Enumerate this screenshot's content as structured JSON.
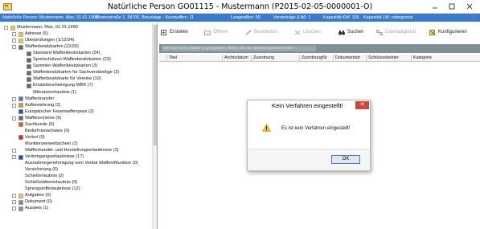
{
  "window": {
    "title": "Natürliche Person GO01115 - Mustermann (P2015-02-05-0000001-O)"
  },
  "infobar": {
    "person": "Natürliche Person: Mustermann, Max, 01.01.1990",
    "address": "Musterstraße 1, 38700, Braunlage - Kurzwaffen: 11",
    "langwaffen": "Langwaffen: 59",
    "voreintraege": "Voreinträge (LW): 1",
    "kapazitaet_kw": "Kapazität KW: 135",
    "kapazitaet_lw": "Kapazität LW: unbegrenzt",
    "alert": "!"
  },
  "tree": {
    "items": [
      {
        "label": "Mustermann, Max, 01.01.1990",
        "icon": "folder-icon"
      },
      {
        "label": "Adresse (5)",
        "icon": "folder-icon"
      },
      {
        "label": "Überprüfungen (1/12/24)",
        "icon": "folder-icon"
      },
      {
        "label": "Waffenbesitzkarten (22/20)",
        "icon": "gun-icon"
      },
      {
        "label": "Standard-Waffenbesitzkarten (24)",
        "icon": "gun-icon"
      },
      {
        "label": "Sportschützen-Waffenbesitzkarten (23)",
        "icon": "gun-icon"
      },
      {
        "label": "Sammler-Waffenbesitzkarten (3)",
        "icon": "gun-icon"
      },
      {
        "label": "Waffenbesitzkarten für Sachverständige (3)",
        "icon": "gun-icon"
      },
      {
        "label": "Waffenbesitzkarte für Vereine (10)",
        "icon": "gun-icon"
      },
      {
        "label": "Ersatzbescheinigung WBK (7)",
        "icon": "gun-icon"
      },
      {
        "label": "Mitnutzererlaubnis (1)",
        "icon": "none"
      },
      {
        "label": "Waffentransfer",
        "icon": "transfer-icon"
      },
      {
        "label": "Aufbewahrung (2)",
        "icon": "key-icon"
      },
      {
        "label": "Europäischer Feuerwaffenpass (2)",
        "icon": "eu-flag-icon"
      },
      {
        "label": "Waffenscheine (9)",
        "icon": "gun-icon"
      },
      {
        "label": "Sachkunde (0)",
        "icon": "book-icon"
      },
      {
        "label": "Bedürfnisnachweis (0)",
        "icon": "none"
      },
      {
        "label": "Verbot (0)",
        "icon": "ban-icon"
      },
      {
        "label": "Munitionserwerbschein (2)",
        "icon": "none"
      },
      {
        "label": "Waffenhandel- und Herstellungserlaubnisse (3)",
        "icon": "none"
      },
      {
        "label": "Verbringungserlaubnisse (17)",
        "icon": "eu-flag-icon"
      },
      {
        "label": "Ausnahmegenehmigung vom Verbot Waffen/Munition (0)",
        "icon": "none"
      },
      {
        "label": "Versicherung (0)",
        "icon": "none"
      },
      {
        "label": "Schießerlaubnis (2)",
        "icon": "none"
      },
      {
        "label": "Schießstättenerlaubnis (0)",
        "icon": "none"
      },
      {
        "label": "Sprengstofferlaubnisse (12)",
        "icon": "none"
      },
      {
        "label": "Aufgaben (0)",
        "icon": "folder-icon"
      },
      {
        "label": "Dokument (0)",
        "icon": "document-icon"
      },
      {
        "label": "Ausweis (1)",
        "icon": "document-icon"
      }
    ]
  },
  "toolbar": {
    "erstellen": "Erstellen",
    "oeffnen": "Öffnen",
    "bearbeiten": "Bearbeiten",
    "loeschen": "Löschen",
    "suchen": "Suchen",
    "datenabgleich": "Datenabgleich",
    "konfigurieren": "Konfigurieren"
  },
  "groupbar": {
    "placeholder": "Um nach einer Spalte zu gruppieren, ziehen Sie die Spaltenkopfzeile hierher."
  },
  "grid": {
    "columns": [
      "Titel",
      "Archivdatum",
      "Zuordnung",
      "ZuordnungNr",
      "Dokumentart",
      "Schlüsselwörter",
      "Kategorie"
    ]
  },
  "dialog": {
    "title": "Kein Verfahren eingestellt!",
    "message": "Es ist kein Verfahren eingestellt!",
    "ok": "OK",
    "close": "✕"
  },
  "colors": {
    "infobar": "#3a7ac8",
    "groupbar": "#7f8f96",
    "close_button": "#c94a3c"
  }
}
